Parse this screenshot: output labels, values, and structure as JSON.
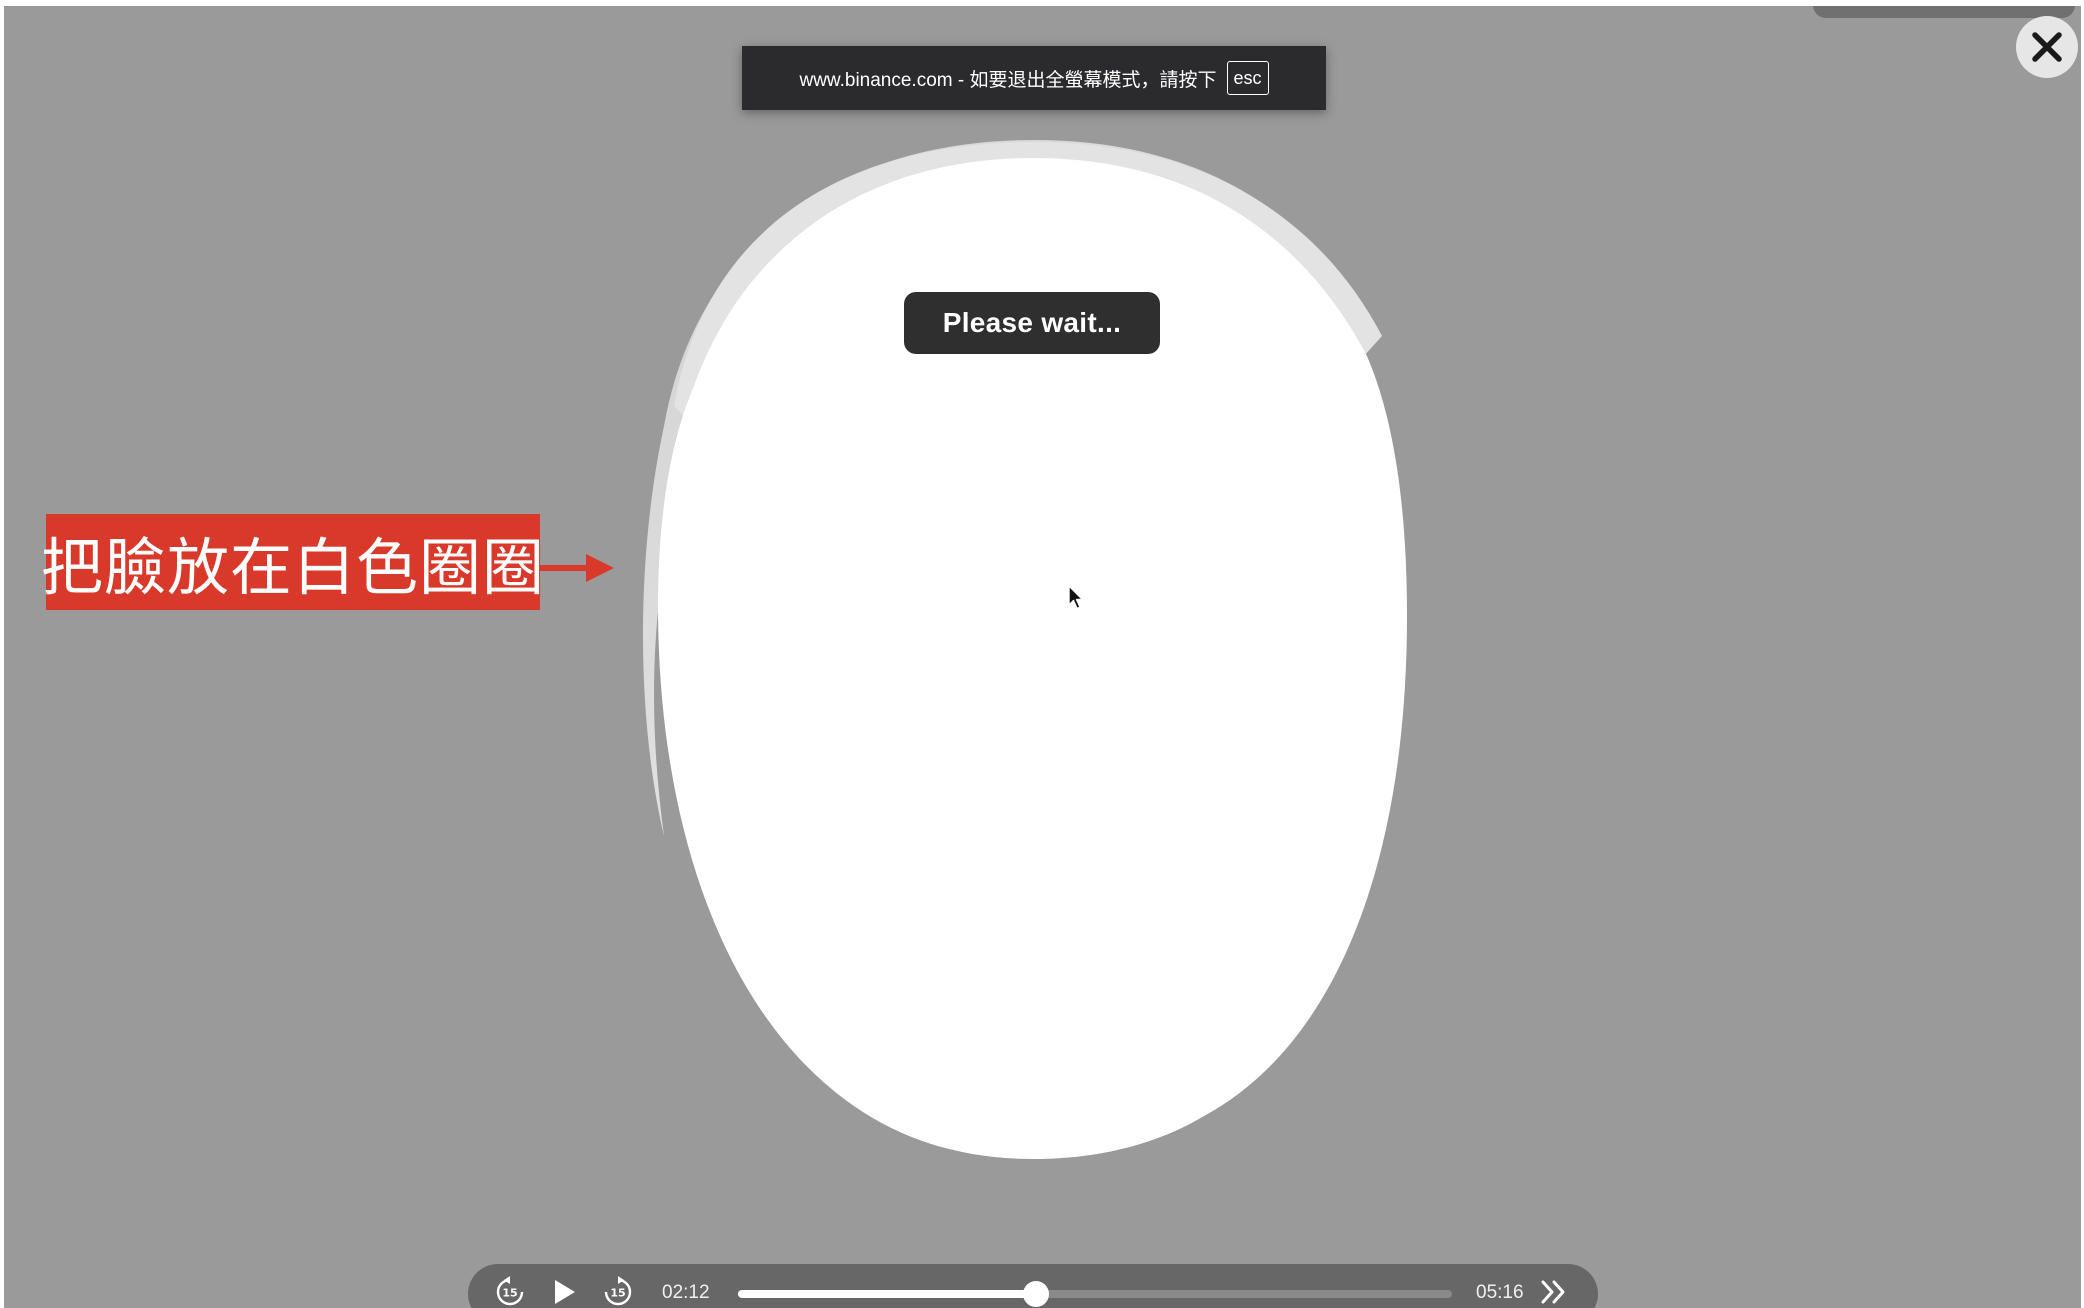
{
  "fullscreen_banner": {
    "text": "www.binance.com - 如要退出全螢幕模式，請按下",
    "key": "esc"
  },
  "status_message": "Please wait...",
  "annotation": {
    "text": "把臉放在白色圈圈",
    "color": "#d9392b"
  },
  "player": {
    "current_time": "02:12",
    "total_time": "05:16",
    "progress": 0.418,
    "rewind_seconds": "15",
    "forward_seconds": "15"
  },
  "icons": {
    "close": "close-icon",
    "play": "play-icon",
    "rewind": "rewind-15-icon",
    "forward": "forward-15-icon",
    "skip": "double-chevron-right-icon",
    "cursor": "mouse-cursor-icon",
    "arrow": "arrow-right-icon"
  },
  "colors": {
    "background": "#9a9a9a",
    "oval": "#ffffff",
    "banner": "#2b2b2e",
    "player_bar": "#676767"
  }
}
